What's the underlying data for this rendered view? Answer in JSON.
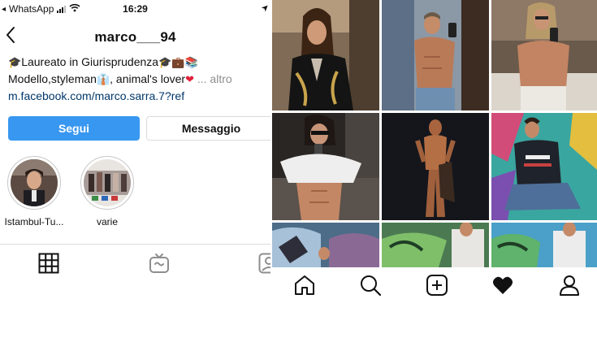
{
  "status_bar": {
    "carrier_arrow": "◂",
    "carrier": "WhatsApp",
    "time": "16:29",
    "location_arrow": "➤"
  },
  "profile": {
    "username": "marco___94",
    "bio": {
      "line1": "Laureato in Giurisprudenza",
      "line2_text": "Modello,styleman",
      "line2_rest": ", animal's lover",
      "more": "... altro",
      "link": "m.facebook.com/marco.sarra.7?ref"
    },
    "follow_label": "Segui",
    "message_label": "Messaggio"
  },
  "highlights": [
    {
      "label": "Istambul-Tu..."
    },
    {
      "label": "varie"
    }
  ],
  "colors": {
    "follow_button": "#3897f0",
    "link": "#00376b",
    "heart": "#e0213a",
    "divider": "#dbdbdb"
  },
  "icons": {
    "grid_tab": "grid-icon",
    "igtv_tab": "igtv-icon",
    "tagged_tab": "tagged-icon",
    "home": "home-icon",
    "search": "search-icon",
    "add": "add-post-icon",
    "activity": "heart-icon",
    "profile": "profile-icon"
  }
}
